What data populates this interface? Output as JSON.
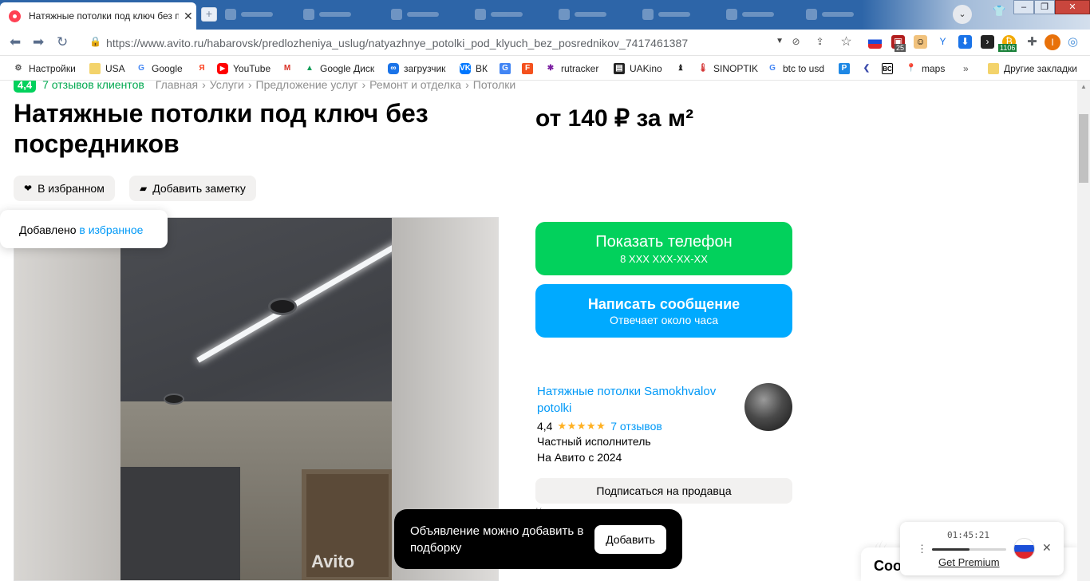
{
  "browser": {
    "tab_title": "Натяжные потолки под ключ без посредников",
    "tab_close": "✕",
    "url_host": "https://www.avito.ru",
    "url_path": "/habarovsk/predlozheniya_uslug/natyazhnye_potolki_pod_klyuch_bez_posrednikov_7417461387",
    "ext_badge_1": "25",
    "ext_badge_2": "1106",
    "profile_letter": "I",
    "bookmarks": [
      {
        "label": "Настройки",
        "icon": "gear-icon"
      },
      {
        "label": "USA",
        "icon": "folder-icon"
      },
      {
        "label": "Google",
        "icon": "google-icon"
      },
      {
        "label": "Яндекс",
        "icon": "yandex-icon"
      },
      {
        "label": "YouTube",
        "icon": "youtube-icon"
      },
      {
        "label": "",
        "icon": "gmail-icon"
      },
      {
        "label": "Google Диск",
        "icon": "drive-icon"
      },
      {
        "label": "загрузчик",
        "icon": "loop-icon"
      },
      {
        "label": "ВК",
        "icon": "vk-icon"
      },
      {
        "label": "",
        "icon": "translate-icon"
      },
      {
        "label": "",
        "icon": "f-icon"
      },
      {
        "label": "rutracker",
        "icon": "rutracker-icon"
      },
      {
        "label": "UAKino",
        "icon": "film-icon"
      },
      {
        "label": "",
        "icon": "chess-icon"
      },
      {
        "label": "SINOPTIK",
        "icon": "thermometer-icon"
      },
      {
        "label": "btc to usd",
        "icon": "google-icon"
      },
      {
        "label": "",
        "icon": "p-icon"
      },
      {
        "label": "",
        "icon": "back-icon"
      },
      {
        "label": "",
        "icon": "bc-icon"
      },
      {
        "label": "maps",
        "icon": "maps-icon"
      }
    ],
    "more": "»",
    "other_bookmarks": "Другие закладки"
  },
  "page": {
    "rating": "4,4",
    "reviews_link": "7 отзывов клиентов",
    "breadcrumbs": [
      "Главная",
      "Услуги",
      "Предложение услуг",
      "Ремонт и отделка",
      "Потолки"
    ],
    "title": "Натяжные потолки под ключ без посредников",
    "price": "от 140 ₽ за м²",
    "fav_button": "В избранном",
    "note_button": "Добавить заметку",
    "fav_toast_text": "Добавлено",
    "fav_toast_link": "в избранное",
    "photo_watermark": "Avito",
    "phone_button": "Показать телефон",
    "phone_masked": "8 XXX XXX-XX-XX",
    "message_button": "Написать сообщение",
    "message_sub": "Отвечает около часа",
    "seller_name": "Натяжные потолки Samokhvalov potolki",
    "seller_rating": "4,4",
    "seller_stars": "★★★★★",
    "seller_reviews": "7 отзывов",
    "seller_type": "Частный исполнитель",
    "seller_since": "На Авито с 2024",
    "subscribe_button": "Подписаться на продавца",
    "clipped_text": "Контактное лицо",
    "collection_toast": "Объявление можно добавить в подборку",
    "collection_button": "Добавить",
    "cookie_title": "Coo"
  },
  "widget": {
    "time": "01:45:21",
    "menu": "⋮",
    "progress": 0.5,
    "close": "✕",
    "premium": "Get Premium"
  },
  "colors": {
    "avito_green": "#02d15c",
    "avito_blue": "#00aaff",
    "link_blue": "#0099f7"
  }
}
